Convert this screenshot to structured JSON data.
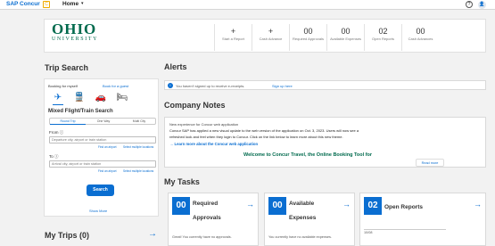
{
  "topbar": {
    "brand": "SAP Concur",
    "brand_mark": "C",
    "home": "Home",
    "home_chevron": "▾",
    "help": "?",
    "user": "👤"
  },
  "header": {
    "logo_title": "OHIO",
    "logo_sub": "UNIVERSITY",
    "tiles": [
      {
        "value": "+",
        "label": "Start a Report"
      },
      {
        "value": "+",
        "label": "Cash Advance"
      },
      {
        "value": "00",
        "label": "Required Approvals"
      },
      {
        "value": "00",
        "label": "Available Expenses"
      },
      {
        "value": "02",
        "label": "Open Reports"
      },
      {
        "value": "00",
        "label": "Cash Advances"
      }
    ]
  },
  "trip_search": {
    "title": "Trip Search",
    "booking_for": "Booking for myself",
    "book_for_guest": "Book for a guest",
    "mode_icons": [
      "✈",
      "🚆",
      "🚗",
      "🛏"
    ],
    "heading": "Mixed Flight/Train Search",
    "segments": [
      "Round Trip",
      "One Way",
      "Multi City"
    ],
    "from_label": "From ⓘ",
    "from_placeholder": "Departure city, airport or train station",
    "to_label": "To ⓘ",
    "to_placeholder": "Arrival city, airport or train station",
    "find_airport": "Find an airport",
    "select_location": "Select multiple locations",
    "search_button": "Search",
    "show_more": "Show More"
  },
  "alerts": {
    "title": "Alerts",
    "icon": "i",
    "message": "You haven't signed up to receive e-receipts.",
    "link": "Sign up here"
  },
  "company_notes": {
    "title": "Company Notes",
    "line1": "New experience for Concur web application",
    "line2": "Concur SAP has applied a new visual update to the web version of the application on Oct. 3, 2023. Users will now see a",
    "line3": "refreshed look and feel when they login to Concur. Click on the link below to learn more about this new theme.",
    "learn_more": "Learn more about the Concur web application",
    "welcome": "Welcome to Concur Travel, the Online Booking Tool for",
    "read_more": "Read more"
  },
  "my_trips": {
    "title": "My Trips (0)"
  },
  "my_tasks": {
    "title": "My Tasks",
    "cards": [
      {
        "count": "00",
        "label1": "Required",
        "label2": "Approvals",
        "msg": "Great! You currently have no approvals."
      },
      {
        "count": "00",
        "label1": "Available",
        "label2": "Expenses",
        "msg": "You currently have no available expenses."
      },
      {
        "count": "02",
        "label1": "Open Reports",
        "label2": "",
        "msg": "10/08"
      }
    ]
  },
  "colors": {
    "brand_blue": "#0a6ed1",
    "ohio_green": "#006a4d",
    "sap_gold": "#f0ab00"
  }
}
